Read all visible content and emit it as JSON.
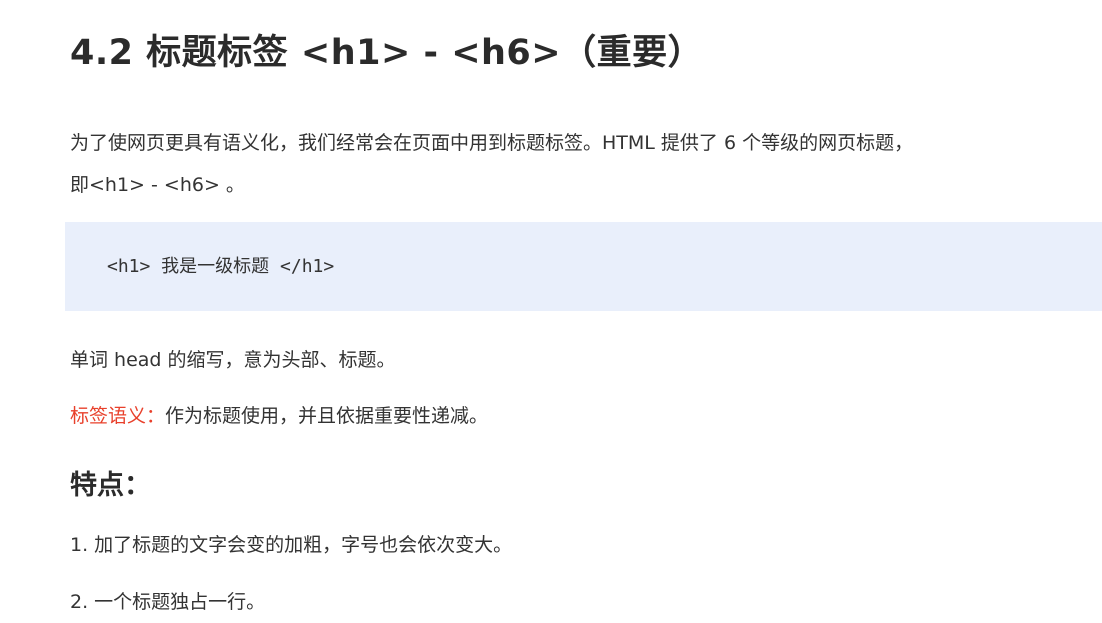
{
  "heading": "4.2 标题标签 <h1> - <h6>（重要）",
  "intro_line1": "为了使网页更具有语义化，我们经常会在页面中用到标题标签。HTML 提供了 6 个等级的网页标题，",
  "intro_line2": "即<h1> - <h6> 。",
  "code_example": "<h1> 我是一级标题 </h1>",
  "abbrev_text": "单词 head 的缩写，意为头部、标题。",
  "semantics": {
    "label": "标签语义：",
    "text": "作为标题使用，并且依据重要性递减。"
  },
  "features_heading": "特点：",
  "features": [
    "1. 加了标题的文字会变的加粗，字号也会依次变大。",
    "2. 一个标题独占一行。"
  ],
  "colors": {
    "semantic_label": "#e8402b",
    "code_background": "#e9effb"
  }
}
